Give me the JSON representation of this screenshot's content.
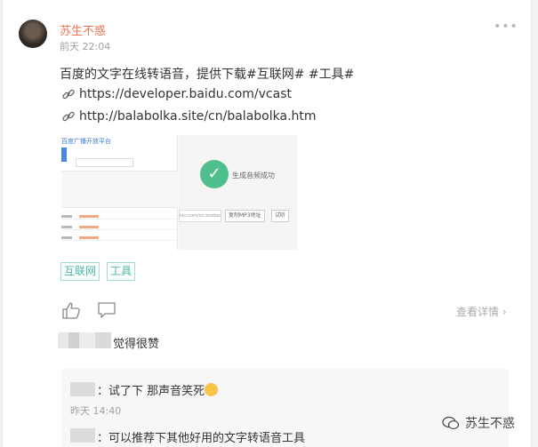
{
  "post": {
    "author": "苏生不惑",
    "time": "前天 22:04",
    "more": "•••",
    "text": "百度的文字在线转语音，提供下载#互联网# #工具#",
    "links": [
      "https://developer.baidu.com/vcast",
      "http://balabolka.site/cn/balabolka.htm"
    ]
  },
  "preview": {
    "left_title": "百度广播开放平台",
    "success_text": "生成音频成功",
    "url_text": "idu.com/cn.bcebos.com/vcast",
    "copy_btn": "复制MP3地址",
    "listen_btn": "试听"
  },
  "tags": [
    "互联网",
    "工具"
  ],
  "actions": {
    "detail": "查看详情"
  },
  "likes": {
    "text": "觉得很赞"
  },
  "comments": [
    {
      "text": "：试了下 那声音笑死",
      "time": "昨天 14:40"
    },
    {
      "text": "：可以推荐下其他好用的文字转语音工具"
    }
  ],
  "watermark": "苏生不惑",
  "colors": {
    "author": "#eb7350",
    "tag": "#4cb6a6",
    "success": "#4fc08d"
  }
}
